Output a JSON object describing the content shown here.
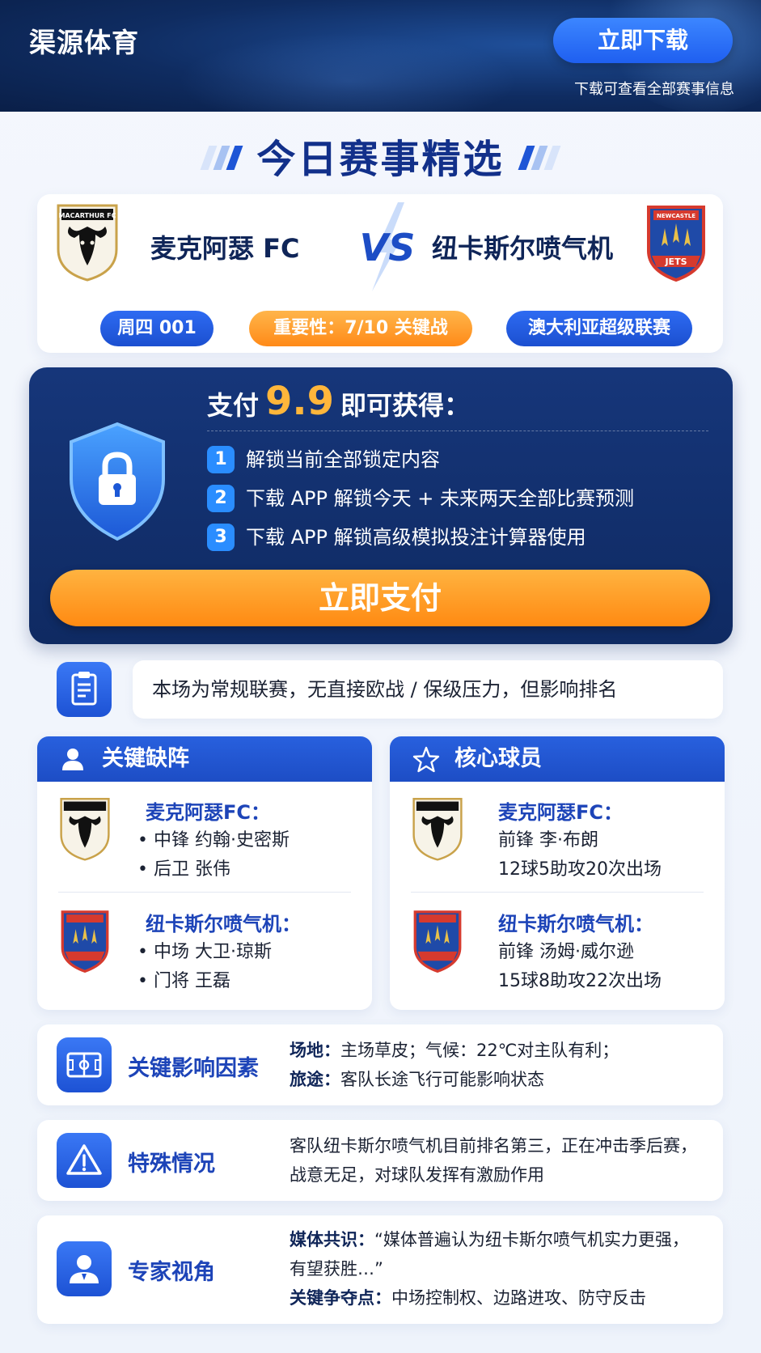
{
  "header": {
    "brand": "渠源体育",
    "download_button": "立即下载",
    "download_hint": "下载可查看全部赛事信息"
  },
  "section_title": "今日赛事精选",
  "match": {
    "home_team": "麦克阿瑟 FC",
    "away_team": "纽卡斯尔喷气机",
    "vs": "VS",
    "home_logo_text": "MACARTHUR FC",
    "away_logo_text": "NEWCASTLE JETS",
    "week_tag": "周四 001",
    "importance_tag": "重要性：7/10 关键战",
    "league_tag": "澳大利亚超级联赛"
  },
  "pay": {
    "prefix": "支付",
    "price": "9.9",
    "suffix": "即可获得：",
    "benefits": [
      {
        "num": "1",
        "text": "解锁当前全部锁定内容"
      },
      {
        "num": "2",
        "text": "下载 APP 解锁今天 + 未来两天全部比赛预测"
      },
      {
        "num": "3",
        "text": "下载 APP 解锁高级模拟投注计算器使用"
      }
    ],
    "pay_button": "立即支付"
  },
  "note": "本场为常规联赛，无直接欧战 / 保级压力，但影响排名",
  "absences": {
    "title": "关键缺阵",
    "home_team": "麦克阿瑟FC：",
    "home_lines": [
      "• 中锋 约翰·史密斯",
      "• 后卫 张伟"
    ],
    "away_team": "纽卡斯尔喷气机：",
    "away_lines": [
      "• 中场 大卫·琼斯",
      "• 门将 王磊"
    ]
  },
  "core_players": {
    "title": "核心球员",
    "home_team": "麦克阿瑟FC：",
    "home_lines": [
      "前锋 李·布朗",
      "12球5助攻20次出场"
    ],
    "away_team": "纽卡斯尔喷气机：",
    "away_lines": [
      "前锋 汤姆·威尔逊",
      "15球8助攻22次出场"
    ]
  },
  "factors": {
    "title": "关键影响因素",
    "line1_label": "场地：",
    "line1_text": "主场草皮；气候：22℃对主队有利；",
    "line2_label": "旅途：",
    "line2_text": "客队长途飞行可能影响状态"
  },
  "special": {
    "title": "特殊情况",
    "line1": "客队纽卡斯尔喷气机目前排名第三，正在冲击季后赛，",
    "line2": "战意无足，对球队发挥有激励作用"
  },
  "expert": {
    "title": "专家视角",
    "line1_label": "媒体共识：",
    "line1_text": "“媒体普遍认为纽卡斯尔喷气机实力更强，",
    "line2_text": "有望获胜…”",
    "line3_label": "关键争夺点：",
    "line3_text": "中场控制权、边路进攻、防守反击"
  },
  "colors": {
    "brand_blue": "#1d4dc5",
    "accent_orange": "#ff8a12",
    "price_gold": "#ffb63b",
    "pay_card_bg": "#0f2a62"
  }
}
